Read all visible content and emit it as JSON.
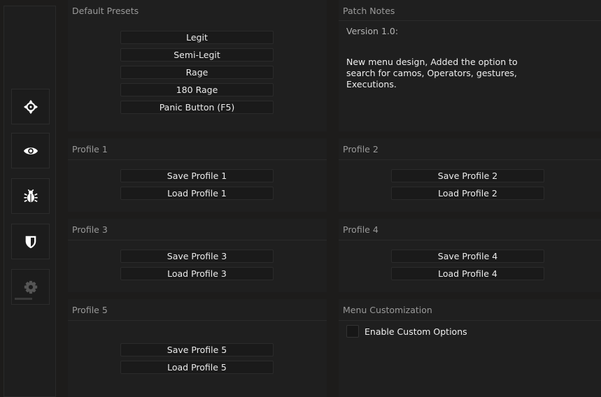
{
  "sidebar": {
    "items": [
      {
        "icon": "crosshair-icon",
        "name": "aim"
      },
      {
        "icon": "eye-icon",
        "name": "visuals"
      },
      {
        "icon": "bug-icon",
        "name": "misc"
      },
      {
        "icon": "shield-icon",
        "name": "protection"
      },
      {
        "icon": "gear-icon",
        "name": "settings"
      }
    ]
  },
  "default_presets": {
    "title": "Default Presets",
    "buttons": [
      "Legit",
      "Semi-Legit",
      "Rage",
      "180 Rage",
      "Panic Button (F5)"
    ]
  },
  "patch_notes": {
    "title": "Patch Notes",
    "version": "Version 1.0:",
    "body": "New menu design, Added the option to search for camos, Operators, gestures, Executions."
  },
  "profiles": [
    {
      "title": "Profile 1",
      "save": "Save Profile 1",
      "load": "Load Profile 1"
    },
    {
      "title": "Profile 2",
      "save": "Save Profile 2",
      "load": "Load Profile 2"
    },
    {
      "title": "Profile 3",
      "save": "Save Profile 3",
      "load": "Load Profile 3"
    },
    {
      "title": "Profile 4",
      "save": "Save Profile 4",
      "load": "Load Profile 4"
    },
    {
      "title": "Profile 5",
      "save": "Save Profile 5",
      "load": "Load Profile 5"
    }
  ],
  "menu_customization": {
    "title": "Menu Customization",
    "checkbox_label": "Enable Custom Options",
    "checked": false
  }
}
